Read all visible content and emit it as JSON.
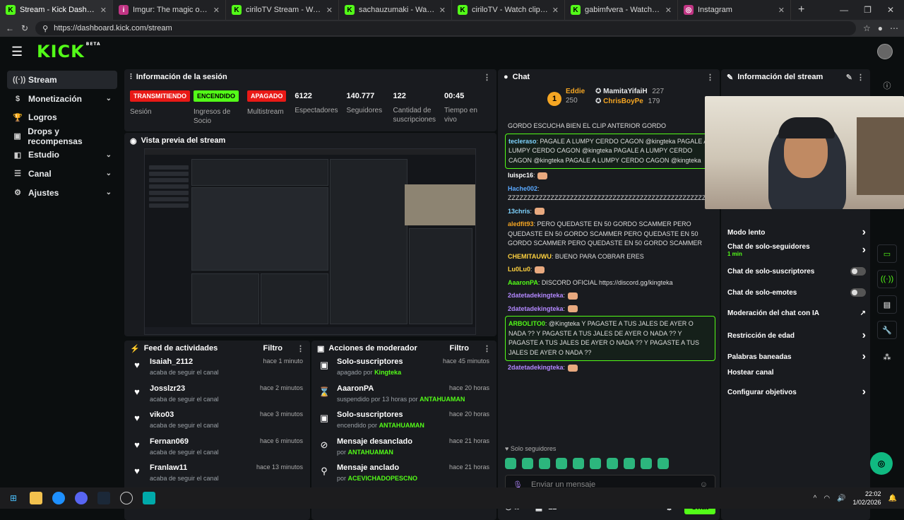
{
  "browser": {
    "tabs": [
      {
        "title": "Stream - Kick Dashboard",
        "icon": "K"
      },
      {
        "title": "Imgur: The magic of the Internet",
        "icon": "i"
      },
      {
        "title": "ciriloTV Stream - Watch Live on Ki",
        "icon": "K"
      },
      {
        "title": "sachauzumaki - Watch clips on Ki",
        "icon": "K"
      },
      {
        "title": "ciriloTV - Watch clips on Kick",
        "icon": "K"
      },
      {
        "title": "gabimfvera - Watch clips on Kick",
        "icon": "K"
      },
      {
        "title": "Instagram",
        "icon": "◎"
      }
    ],
    "url": "https://dashboard.kick.com/stream"
  },
  "app": {
    "logo": "KICK",
    "beta": "BETA"
  },
  "sidebar": {
    "items": [
      {
        "label": "Stream",
        "icon": "radio-icon",
        "chev": ""
      },
      {
        "label": "Monetización",
        "icon": "dollar-icon",
        "chev": "⌄"
      },
      {
        "label": "Logros",
        "icon": "trophy-icon",
        "chev": ""
      },
      {
        "label": "Drops y recompensas",
        "icon": "gift-icon",
        "chev": ""
      },
      {
        "label": "Estudio",
        "icon": "studio-icon",
        "chev": "⌄"
      },
      {
        "label": "Canal",
        "icon": "channel-icon",
        "chev": "⌄"
      },
      {
        "label": "Ajustes",
        "icon": "gear-icon",
        "chev": "⌄"
      }
    ]
  },
  "session": {
    "title": "Información de la sesión",
    "stats": [
      {
        "value": "TRANSMITIENDO",
        "kind": "red",
        "label": "Sesión"
      },
      {
        "value": "ENCENDIDO",
        "kind": "green",
        "label": "Ingresos de Socio"
      },
      {
        "value": "APAGADO",
        "kind": "red",
        "label": "Multistream"
      },
      {
        "value": "6122",
        "kind": "num",
        "label": "Espectadores"
      },
      {
        "value": "140.777",
        "kind": "num",
        "label": "Seguidores"
      },
      {
        "value": "122",
        "kind": "num",
        "label": "Cantidad de suscripciones"
      },
      {
        "value": "00:45",
        "kind": "num",
        "label": "Tiempo en vivo"
      }
    ]
  },
  "preview": {
    "title": "Vista previa del stream"
  },
  "feed": {
    "title": "Feed de actividades",
    "filter": "Filtro",
    "items": [
      {
        "name": "Isaiah_2112",
        "sub": "acaba de seguir el canal",
        "time": "hace 1 minuto"
      },
      {
        "name": "Josslzr23",
        "sub": "acaba de seguir el canal",
        "time": "hace 2 minutos"
      },
      {
        "name": "viko03",
        "sub": "acaba de seguir el canal",
        "time": "hace 3 minutos"
      },
      {
        "name": "Fernan069",
        "sub": "acaba de seguir el canal",
        "time": "hace 6 minutos"
      },
      {
        "name": "Franlaw11",
        "sub": "acaba de seguir el canal",
        "time": "hace 13 minutos"
      }
    ]
  },
  "mods": {
    "title": "Acciones de moderador",
    "filter": "Filtro",
    "items": [
      {
        "name": "Solo-suscriptores",
        "sub": "apagado por",
        "who": "Kingteka",
        "time": "hace 45 minutos",
        "icon": "gift-icon"
      },
      {
        "name": "AaaronPA",
        "sub": "suspendido por 13 horas por",
        "who": "ANTAHUAMAN",
        "time": "hace 20 horas",
        "icon": "hourglass-icon"
      },
      {
        "name": "Solo-suscriptores",
        "sub": "encendido por",
        "who": "ANTAHUAMAN",
        "time": "hace 20 horas",
        "icon": "gift-icon"
      },
      {
        "name": "Mensaje desanclado",
        "sub": "por",
        "who": "ANTAHUAMAN",
        "time": "hace 21 horas",
        "icon": "unpin-icon"
      },
      {
        "name": "Mensaje anclado",
        "sub": "por",
        "who": "ACEVICHADOPESCNO",
        "time": "hace 21 horas",
        "icon": "pin-icon"
      }
    ]
  },
  "chat": {
    "title": "Chat",
    "leaders": [
      {
        "rank": "1",
        "name": "Eddie",
        "count": "250",
        "color": "#f5a623"
      },
      {
        "rank": "",
        "name": "MamitaYifaiH",
        "count": "227",
        "color": "#ffffff"
      },
      {
        "rank": "",
        "name": "ChrisBoyPe",
        "count": "179",
        "color": "#f5a623"
      }
    ],
    "messages": [
      {
        "user": "",
        "text": "GORDO ESCUCHA BIEN EL CLIP ANTERIOR GORDO",
        "color": "#ffffff",
        "hl": false
      },
      {
        "user": "tecleraso",
        "text": "PAGALE A LUMPY CERDO CAGON @kingteka PAGALE A LUMPY CERDO CAGON @kingteka PAGALE A LUMPY CERDO CAGON @kingteka PAGALE A LUMPY CERDO CAGON @kingteka",
        "color": "#7fd4ff",
        "hl": true
      },
      {
        "user": "luispc16",
        "text": "",
        "color": "#ffffff",
        "hl": false
      },
      {
        "user": "Hache002",
        "text": "ZZZZZZZZZZZZZZZZZZZZZZZZZZZZZZZZZZZZZZZZZZZZZZZZZZZZZZZZZZZZZZZZZZZZZZZZ",
        "color": "#5aa9ff",
        "hl": false
      },
      {
        "user": "13chris",
        "text": "",
        "color": "#7fd4ff",
        "hl": false
      },
      {
        "user": "aledfit93",
        "text": "PERO QUEDASTE EN 50 GORDO SCAMMER PERO QUEDASTE EN 50 GORDO SCAMMER PERO QUEDASTE EN 50 GORDO SCAMMER PERO QUEDASTE EN 50 GORDO SCAMMER",
        "color": "#f5a623",
        "hl": false
      },
      {
        "user": "CHEMITAUWU",
        "text": "BUENO PARA COBRAR ERES",
        "color": "#ffd23f",
        "hl": false
      },
      {
        "user": "Lu0Lu0",
        "text": "",
        "color": "#ffd23f",
        "hl": false
      },
      {
        "user": "AaaronPA",
        "text": "DISCORD OFICIAL https://discord.gg/kingteka",
        "color": "#53fc18",
        "hl": false
      },
      {
        "user": "2datetadekingteka",
        "text": "",
        "color": "#b388ff",
        "hl": false
      },
      {
        "user": "2datetadekingteka",
        "text": "",
        "color": "#b388ff",
        "hl": false
      },
      {
        "user": "ARBOLITO0",
        "text": "@Kingteka Y PAGASTE A TUS JALES DE AYER O NADA ?? Y PAGASTE A TUS JALES DE AYER O NADA ?? Y PAGASTE A TUS JALES DE AYER O NADA ?? Y PAGASTE A TUS JALES DE AYER O NADA ??",
        "color": "#53fc18",
        "hl": true
      },
      {
        "user": "2datetadekingteka",
        "text": "",
        "color": "#b388ff",
        "hl": false
      }
    ],
    "followers_only": "Solo seguidores",
    "input_placeholder": "Enviar un mensaje",
    "count": "12",
    "send": "Chat"
  },
  "info": {
    "title": "Información del stream",
    "rows": [
      {
        "label": "Modo lento",
        "sub": "",
        "ctrl": "chevron"
      },
      {
        "label": "Chat de solo-seguidores",
        "sub": "1 min",
        "ctrl": "chevron"
      },
      {
        "label": "Chat de solo-suscriptores",
        "sub": "",
        "ctrl": "toggle"
      },
      {
        "label": "Chat de solo-emotes",
        "sub": "",
        "ctrl": "toggle"
      },
      {
        "label": "Moderación del chat con IA",
        "sub": "",
        "ctrl": "external"
      },
      {
        "label": "Restricción de edad",
        "sub": "",
        "ctrl": "chevron"
      },
      {
        "label": "Palabras baneadas",
        "sub": "",
        "ctrl": "chevron"
      },
      {
        "label": "Hostear canal",
        "sub": "",
        "ctrl": "none"
      },
      {
        "label": "Configurar objetivos",
        "sub": "",
        "ctrl": "chevron"
      }
    ]
  },
  "taskbar": {
    "time": "22:02",
    "date": "1/02/2026"
  },
  "colors": {
    "accent": "#53fc18",
    "live": "#e91916",
    "bg": "#0b0e0f",
    "panel": "#191b1f"
  }
}
